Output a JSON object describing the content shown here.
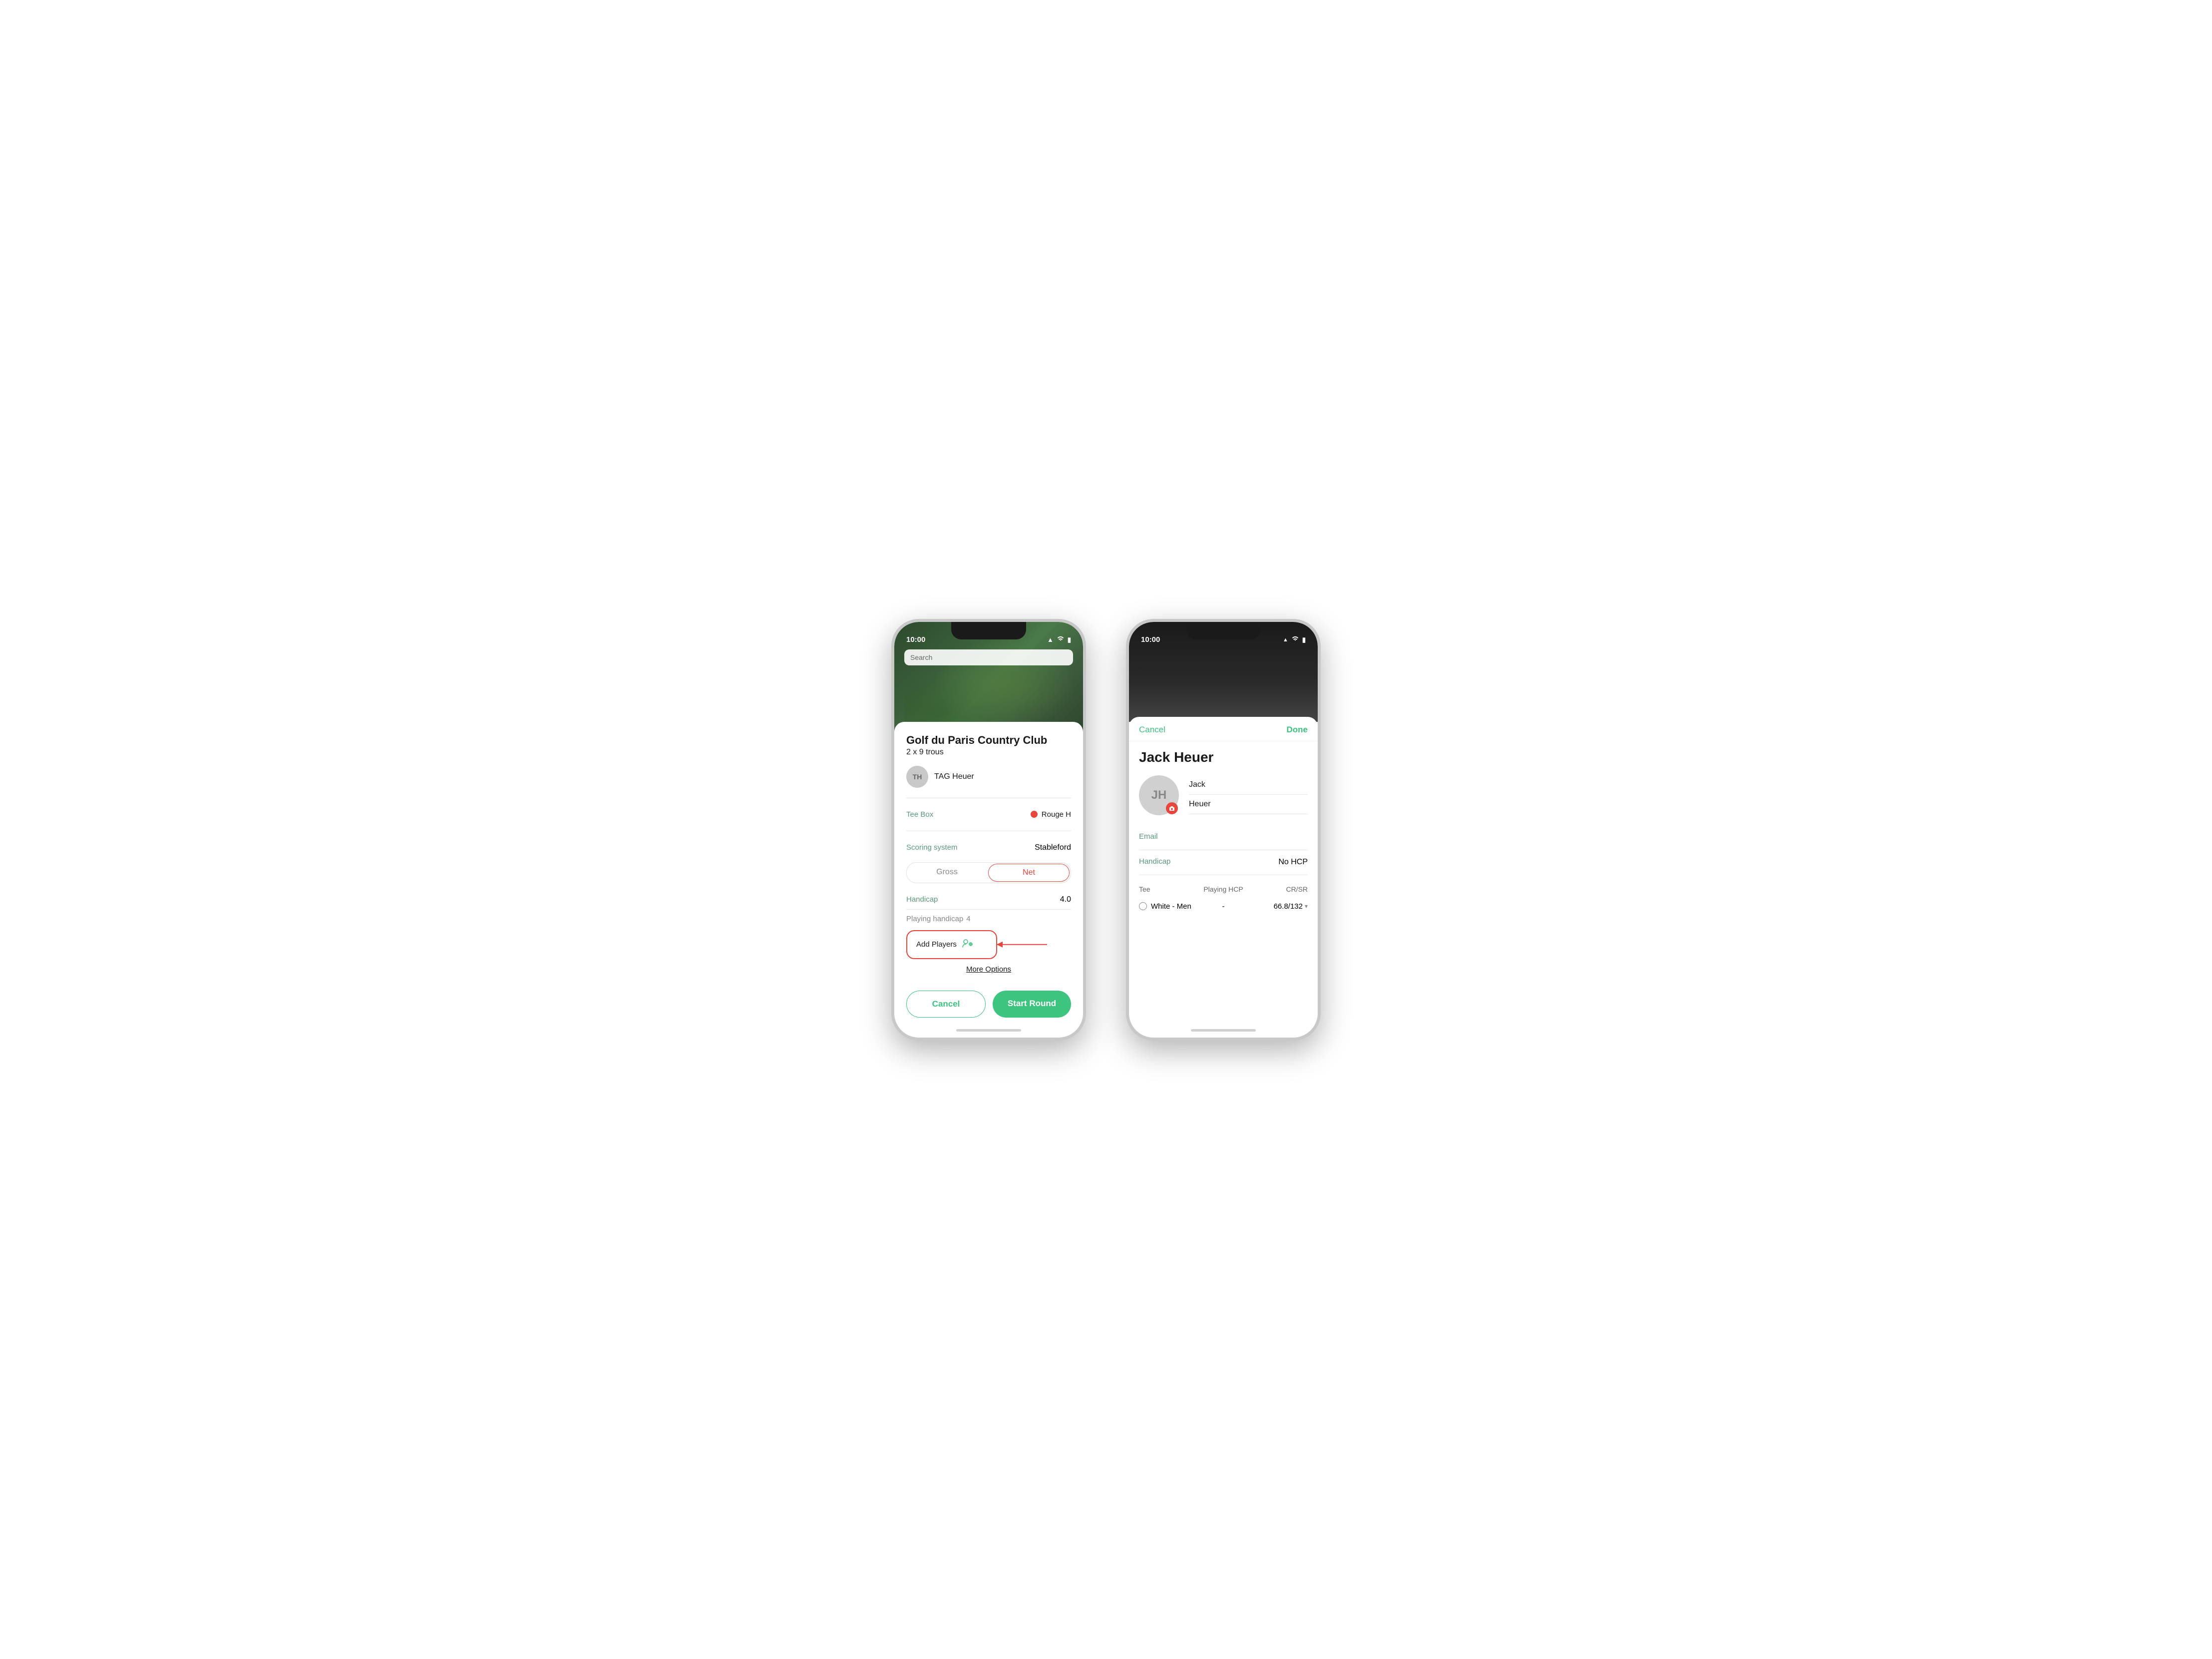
{
  "phone1": {
    "status": {
      "time": "10:00",
      "signal": "📶",
      "wifi": "WiFi",
      "battery": "🔋"
    },
    "map_search": "Search",
    "course": {
      "title": "Golf du Paris Country Club",
      "subtitle": "2 x 9 trous"
    },
    "player": {
      "initials": "TH",
      "name": "TAG Heuer"
    },
    "tee_box": {
      "label": "Tee Box",
      "value": "Rouge H"
    },
    "scoring": {
      "label": "Scoring system",
      "value": "Stableford"
    },
    "gross_label": "Gross",
    "net_label": "Net",
    "handicap": {
      "label": "Handicap",
      "value": "4.0"
    },
    "playing_handicap": {
      "label": "Playing handicap",
      "value": "4"
    },
    "add_players_label": "Add Players",
    "more_options_label": "More Options",
    "cancel_label": "Cancel",
    "start_round_label": "Start Round"
  },
  "phone2": {
    "status": {
      "time": "10:00"
    },
    "cancel_label": "Cancel",
    "done_label": "Done",
    "player_name": "Jack Heuer",
    "avatar_initials": "JH",
    "first_name": "Jack",
    "last_name": "Heuer",
    "email_label": "Email",
    "email_value": "",
    "handicap_label": "Handicap",
    "handicap_value": "No HCP",
    "tee_table": {
      "col_tee": "Tee",
      "col_hcp": "Playing HCP",
      "col_cr": "CR/SR",
      "rows": [
        {
          "tee": "White - Men",
          "hcp": "-",
          "cr": "66.8/132"
        }
      ]
    }
  }
}
